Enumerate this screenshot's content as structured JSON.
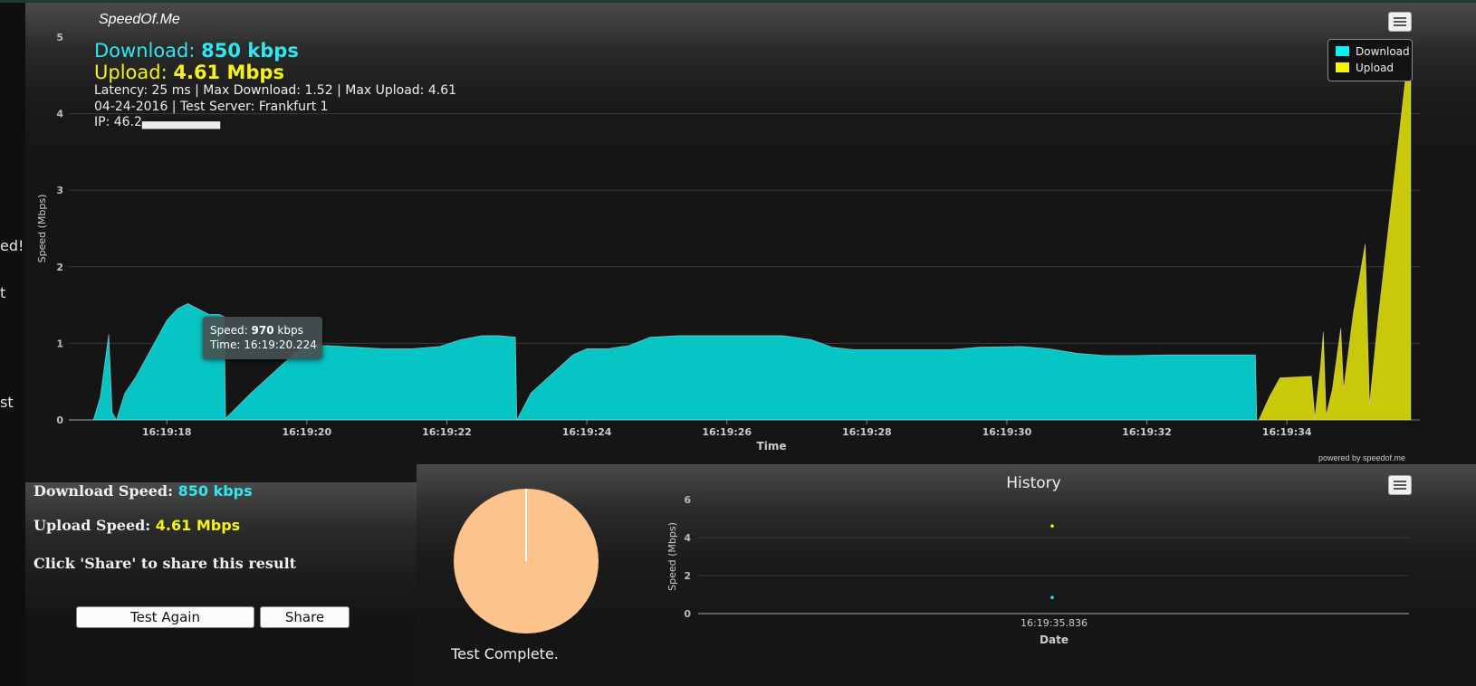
{
  "app": {
    "title": "SpeedOf.Me"
  },
  "left_fragments": [
    "ed!",
    "t",
    "st"
  ],
  "summary": {
    "download_label": "Download:",
    "download_value": "850 kbps",
    "upload_label": "Upload:",
    "upload_value": "4.61 Mbps",
    "line1": "Latency: 25 ms | Max Download: 1.52 | Max Upload: 4.61",
    "line2": "04-24-2016 | Test Server: Frankfurt 1",
    "line3": "IP: 46.2▄▄▄▄▄▄▄▄"
  },
  "legend": {
    "download": "Download",
    "upload": "Upload"
  },
  "tooltip": {
    "speed_label": "Speed:",
    "speed_value": "970",
    "speed_unit": "kbps",
    "time_label": "Time:",
    "time_value": "16:19:20.224"
  },
  "powered_by": "powered by speedof.me",
  "colors": {
    "download": "#07c5c5",
    "upload": "#c9c90a",
    "accent_cyan": "#2fe7ee",
    "accent_yellow": "#f4f21a",
    "pie": "#fcc38c"
  },
  "chart_data": [
    {
      "type": "area",
      "ylabel": "Speed (Mbps)",
      "xlabel": "Time",
      "ylim": [
        0,
        5
      ],
      "y_ticks": [
        "0",
        "1",
        "2",
        "3",
        "4",
        "5"
      ],
      "x_ticks": [
        "16:19:18",
        "16:19:20",
        "16:19:22",
        "16:19:24",
        "16:19:26",
        "16:19:28",
        "16:19:30",
        "16:19:32",
        "16:19:34"
      ],
      "grid": true,
      "legend_position": "top-right",
      "series": [
        {
          "name": "Download",
          "points": [
            [
              16.6,
              0
            ],
            [
              16.95,
              0.0
            ],
            [
              17.05,
              0.3
            ],
            [
              17.17,
              1.12
            ],
            [
              17.22,
              0.1
            ],
            [
              17.28,
              0
            ],
            [
              17.4,
              0.35
            ],
            [
              17.55,
              0.55
            ],
            [
              17.7,
              0.8
            ],
            [
              17.85,
              1.05
            ],
            [
              18.0,
              1.3
            ],
            [
              18.15,
              1.45
            ],
            [
              18.3,
              1.52
            ],
            [
              18.45,
              1.45
            ],
            [
              18.6,
              1.38
            ],
            [
              18.75,
              1.38
            ],
            [
              18.82,
              1.35
            ],
            [
              18.84,
              0.02
            ],
            [
              18.95,
              0.12
            ],
            [
              19.2,
              0.35
            ],
            [
              19.5,
              0.6
            ],
            [
              19.8,
              0.85
            ],
            [
              20.0,
              0.97
            ],
            [
              20.3,
              0.97
            ],
            [
              20.7,
              0.95
            ],
            [
              21.1,
              0.93
            ],
            [
              21.5,
              0.93
            ],
            [
              21.9,
              0.96
            ],
            [
              22.2,
              1.05
            ],
            [
              22.5,
              1.1
            ],
            [
              22.75,
              1.1
            ],
            [
              22.98,
              1.08
            ],
            [
              23.0,
              0.0
            ],
            [
              23.2,
              0.35
            ],
            [
              23.5,
              0.6
            ],
            [
              23.8,
              0.85
            ],
            [
              24.0,
              0.93
            ],
            [
              24.3,
              0.93
            ],
            [
              24.6,
              0.97
            ],
            [
              24.9,
              1.08
            ],
            [
              25.3,
              1.1
            ],
            [
              25.8,
              1.1
            ],
            [
              26.3,
              1.1
            ],
            [
              26.8,
              1.1
            ],
            [
              27.2,
              1.05
            ],
            [
              27.5,
              0.95
            ],
            [
              27.8,
              0.92
            ],
            [
              28.3,
              0.92
            ],
            [
              28.8,
              0.92
            ],
            [
              29.2,
              0.92
            ],
            [
              29.6,
              0.95
            ],
            [
              30.2,
              0.96
            ],
            [
              30.6,
              0.93
            ],
            [
              31.0,
              0.87
            ],
            [
              31.4,
              0.84
            ],
            [
              31.8,
              0.84
            ],
            [
              32.3,
              0.85
            ],
            [
              33.0,
              0.85
            ],
            [
              33.55,
              0.85
            ],
            [
              33.57,
              0
            ]
          ]
        },
        {
          "name": "Upload",
          "points": [
            [
              33.6,
              0
            ],
            [
              33.75,
              0.3
            ],
            [
              33.9,
              0.55
            ],
            [
              34.35,
              0.57
            ],
            [
              34.4,
              0.03
            ],
            [
              34.48,
              0.7
            ],
            [
              34.52,
              1.15
            ],
            [
              34.56,
              0.06
            ],
            [
              34.65,
              0.4
            ],
            [
              34.77,
              1.2
            ],
            [
              34.81,
              0.4
            ],
            [
              34.95,
              1.4
            ],
            [
              35.12,
              2.3
            ],
            [
              35.18,
              0.2
            ],
            [
              35.3,
              1.3
            ],
            [
              35.45,
              2.5
            ],
            [
              35.6,
              3.7
            ],
            [
              35.73,
              4.75
            ],
            [
              35.77,
              4.75
            ]
          ]
        }
      ],
      "x_range": [
        16.6,
        35.77
      ]
    },
    {
      "type": "pie",
      "values": [
        100
      ],
      "caption": "Test Complete."
    },
    {
      "type": "scatter",
      "title": "History",
      "ylabel": "Speed (Mbps)",
      "xlabel": "Date",
      "ylim": [
        0,
        6
      ],
      "y_ticks": [
        "0",
        "2",
        "4",
        "6"
      ],
      "x_ticks": [
        "16:19:35.836"
      ],
      "series": [
        {
          "name": "Download",
          "points": [
            [
              "16:19:35.836",
              0.85
            ]
          ]
        },
        {
          "name": "Upload",
          "points": [
            [
              "16:19:35.836",
              4.61
            ]
          ]
        }
      ]
    }
  ],
  "stats": {
    "download_label": "Download Speed:",
    "download_value": "850 kbps",
    "upload_label": "Upload Speed:",
    "upload_value": "4.61 Mbps",
    "share_hint": "Click 'Share' to share this result"
  },
  "buttons": {
    "test_again": "Test Again",
    "share": "Share"
  }
}
